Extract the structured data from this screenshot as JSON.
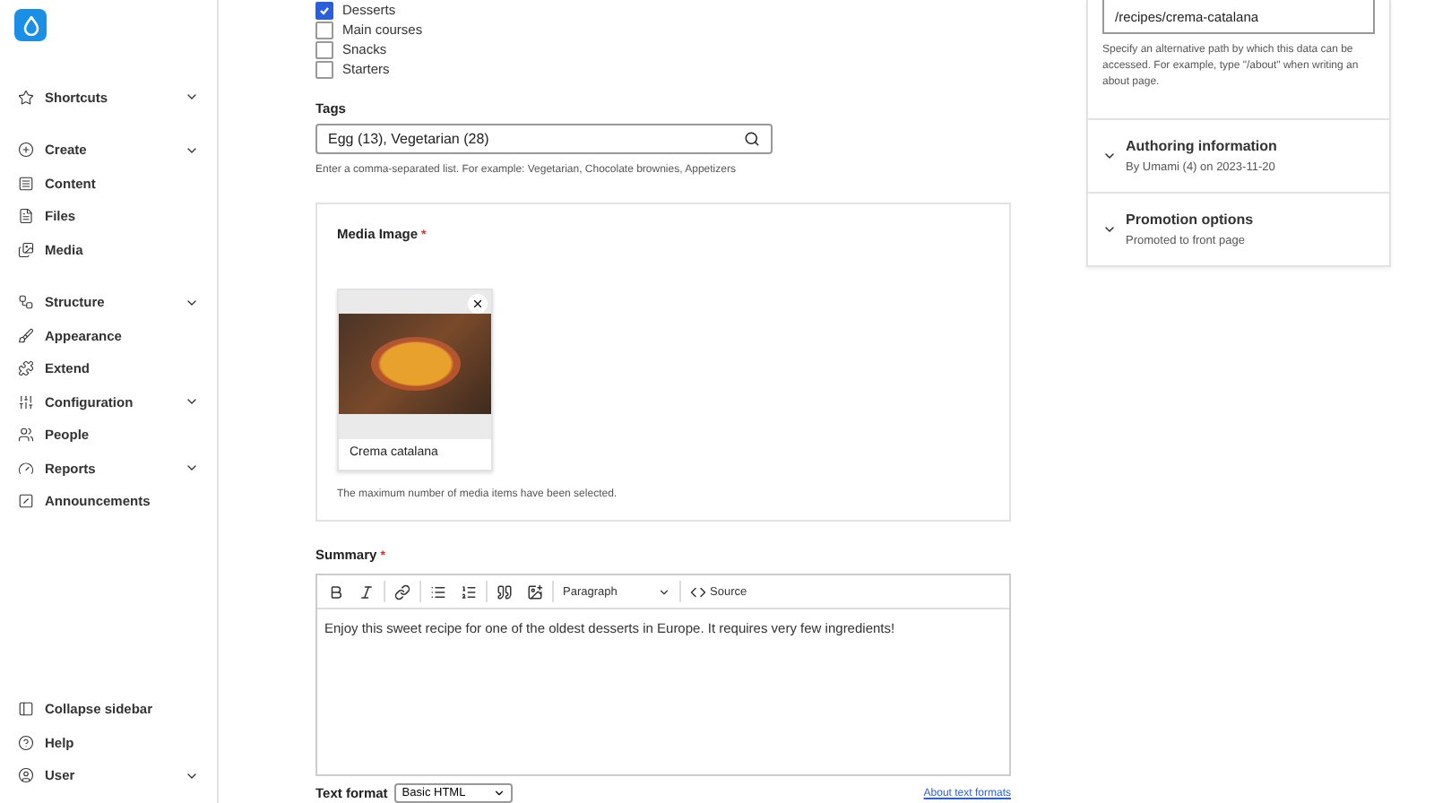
{
  "sidebar": {
    "items": [
      {
        "label": "Shortcuts",
        "expandable": true
      },
      {
        "label": "Create",
        "expandable": true
      },
      {
        "label": "Content",
        "expandable": false
      },
      {
        "label": "Files",
        "expandable": false
      },
      {
        "label": "Media",
        "expandable": false
      },
      {
        "label": "Structure",
        "expandable": true
      },
      {
        "label": "Appearance",
        "expandable": false
      },
      {
        "label": "Extend",
        "expandable": false
      },
      {
        "label": "Configuration",
        "expandable": true
      },
      {
        "label": "People",
        "expandable": false
      },
      {
        "label": "Reports",
        "expandable": true
      },
      {
        "label": "Announcements",
        "expandable": false
      }
    ],
    "footer": [
      {
        "label": "Collapse sidebar",
        "expandable": false
      },
      {
        "label": "Help",
        "expandable": false
      },
      {
        "label": "User",
        "expandable": true
      }
    ]
  },
  "categories": [
    {
      "label": "Desserts",
      "checked": true
    },
    {
      "label": "Main courses",
      "checked": false
    },
    {
      "label": "Snacks",
      "checked": false
    },
    {
      "label": "Starters",
      "checked": false
    }
  ],
  "tags": {
    "label": "Tags",
    "value": "Egg (13), Vegetarian (28)",
    "help": "Enter a comma-separated list. For example: Vegetarian, Chocolate brownies, Appetizers"
  },
  "media": {
    "label": "Media Image",
    "required_mark": "*",
    "item": {
      "name": "Crema catalana"
    },
    "help": "The maximum number of media items have been selected."
  },
  "summary": {
    "label": "Summary",
    "required_mark": "*",
    "style": "Paragraph",
    "source": "Source",
    "body": "Enjoy this sweet recipe for one of the oldest desserts in Europe. It requires very few ingredients!",
    "format_label": "Text format",
    "format": "Basic HTML",
    "format_link": "About text formats"
  },
  "side_panel": {
    "alias": "/recipes/crema-catalana",
    "alias_help": "Specify an alternative path by which this data can be accessed. For example, type \"/about\" when writing an about page.",
    "sections": [
      {
        "title": "Authoring information",
        "summary": "By Umami (4) on 2023-11-20",
        "expanded": false
      },
      {
        "title": "Promotion options",
        "summary": "Promoted to front page",
        "expanded": false
      }
    ]
  }
}
